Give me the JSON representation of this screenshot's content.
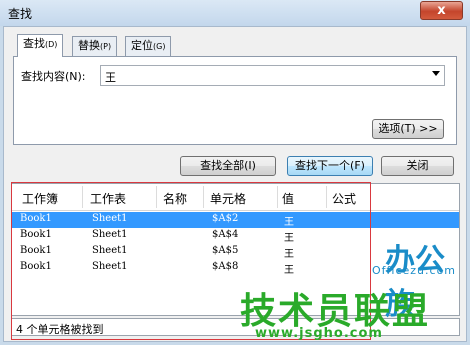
{
  "window": {
    "title": "查找",
    "close_glyph": "x"
  },
  "tabs": [
    {
      "label": "查找",
      "key": "(D)",
      "active": true
    },
    {
      "label": "替换",
      "key": "(P)",
      "active": false
    },
    {
      "label": "定位",
      "key": "(G)",
      "active": false
    }
  ],
  "find": {
    "label": "查找内容(N):",
    "value": "王"
  },
  "buttons": {
    "options": "选项(T) >>",
    "find_all": "查找全部(I)",
    "find_next": "查找下一个(F)",
    "close": "关闭"
  },
  "results": {
    "columns": [
      "工作簿",
      "工作表",
      "名称",
      "单元格",
      "值",
      "公式"
    ],
    "rows": [
      {
        "book": "Book1",
        "sheet": "Sheet1",
        "name": "",
        "cell": "$A$2",
        "value": "王",
        "formula": "",
        "selected": true
      },
      {
        "book": "Book1",
        "sheet": "Sheet1",
        "name": "",
        "cell": "$A$4",
        "value": "王",
        "formula": "",
        "selected": false
      },
      {
        "book": "Book1",
        "sheet": "Sheet1",
        "name": "",
        "cell": "$A$5",
        "value": "王",
        "formula": "",
        "selected": false
      },
      {
        "book": "Book1",
        "sheet": "Sheet1",
        "name": "",
        "cell": "$A$8",
        "value": "王",
        "formula": "",
        "selected": false
      }
    ]
  },
  "status": "4 个单元格被找到",
  "watermarks": {
    "brand1": "办公族",
    "brand1_url": "Officezu.com",
    "brand2": "技术员联盟",
    "brand2_url": "www.jsgho.com"
  },
  "colors": {
    "selection": "#3399ff",
    "highlight_box": "#d9393f",
    "watermark_green": "#2aaa2a",
    "watermark_blue": "#1a8cc8"
  }
}
